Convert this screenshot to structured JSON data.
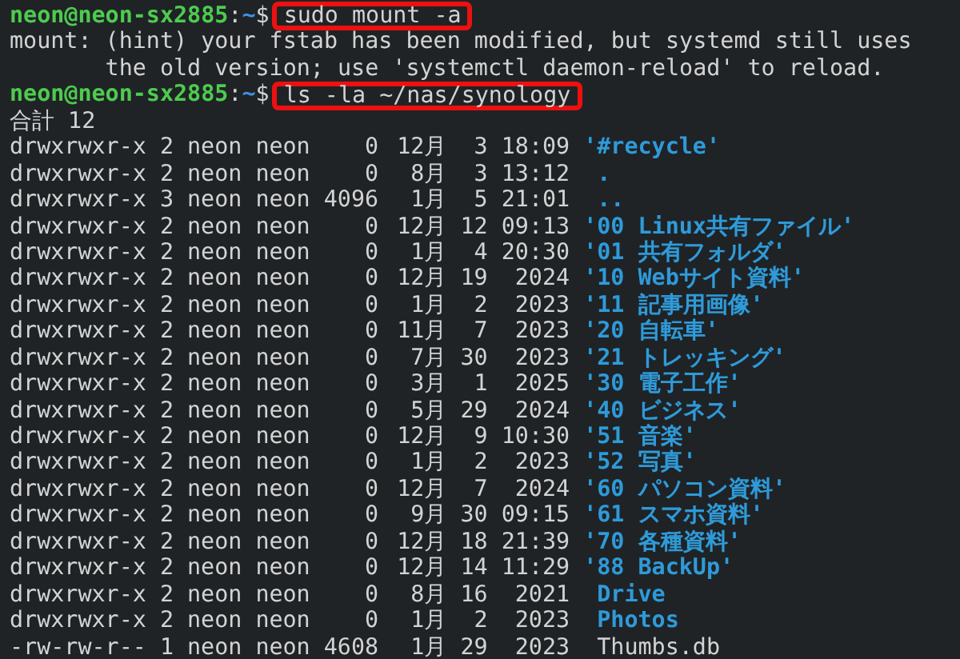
{
  "terminal": {
    "lines": [
      {
        "kind": "prompt",
        "user_host": "neon@neon-sx2885",
        "separator": ":",
        "path": "~",
        "symbol": "$",
        "command": "sudo mount -a",
        "highlighted": true
      },
      {
        "kind": "output",
        "text": "mount: (hint) your fstab has been modified, but systemd still uses"
      },
      {
        "kind": "output",
        "text": "       the old version; use 'systemctl daemon-reload' to reload."
      },
      {
        "kind": "prompt",
        "user_host": "neon@neon-sx2885",
        "separator": ":",
        "path": "~",
        "symbol": "$",
        "command": "ls -la ~/nas/synology",
        "highlighted": true
      },
      {
        "kind": "output",
        "text": "合計 12"
      }
    ],
    "listing": [
      {
        "perms": "drwxrwxr-x",
        "links": "2",
        "owner": "neon",
        "group": "neon",
        "size": "0",
        "month": "12月",
        "day": "3",
        "time": "18:09",
        "name": "'#recycle'",
        "kind": "directory",
        "quoted": true
      },
      {
        "perms": "drwxrwxr-x",
        "links": "2",
        "owner": "neon",
        "group": "neon",
        "size": "0",
        "month": "8月",
        "day": "3",
        "time": "13:12",
        "name": ".",
        "kind": "directory",
        "quoted": false
      },
      {
        "perms": "drwxrwxr-x",
        "links": "3",
        "owner": "neon",
        "group": "neon",
        "size": "4096",
        "month": "1月",
        "day": "5",
        "time": "21:01",
        "name": "..",
        "kind": "directory",
        "quoted": false
      },
      {
        "perms": "drwxrwxr-x",
        "links": "2",
        "owner": "neon",
        "group": "neon",
        "size": "0",
        "month": "12月",
        "day": "12",
        "time": "09:13",
        "name": "'00 Linux共有ファイル'",
        "kind": "directory",
        "quoted": true
      },
      {
        "perms": "drwxrwxr-x",
        "links": "2",
        "owner": "neon",
        "group": "neon",
        "size": "0",
        "month": "1月",
        "day": "4",
        "time": "20:30",
        "name": "'01 共有フォルダ'",
        "kind": "directory",
        "quoted": true
      },
      {
        "perms": "drwxrwxr-x",
        "links": "2",
        "owner": "neon",
        "group": "neon",
        "size": "0",
        "month": "12月",
        "day": "19",
        "time": "2024",
        "name": "'10 Webサイト資料'",
        "kind": "directory",
        "quoted": true
      },
      {
        "perms": "drwxrwxr-x",
        "links": "2",
        "owner": "neon",
        "group": "neon",
        "size": "0",
        "month": "1月",
        "day": "2",
        "time": "2023",
        "name": "'11 記事用画像'",
        "kind": "directory",
        "quoted": true
      },
      {
        "perms": "drwxrwxr-x",
        "links": "2",
        "owner": "neon",
        "group": "neon",
        "size": "0",
        "month": "11月",
        "day": "7",
        "time": "2023",
        "name": "'20 自転車'",
        "kind": "directory",
        "quoted": true
      },
      {
        "perms": "drwxrwxr-x",
        "links": "2",
        "owner": "neon",
        "group": "neon",
        "size": "0",
        "month": "7月",
        "day": "30",
        "time": "2023",
        "name": "'21 トレッキング'",
        "kind": "directory",
        "quoted": true
      },
      {
        "perms": "drwxrwxr-x",
        "links": "2",
        "owner": "neon",
        "group": "neon",
        "size": "0",
        "month": "3月",
        "day": "1",
        "time": "2025",
        "name": "'30 電子工作'",
        "kind": "directory",
        "quoted": true
      },
      {
        "perms": "drwxrwxr-x",
        "links": "2",
        "owner": "neon",
        "group": "neon",
        "size": "0",
        "month": "5月",
        "day": "29",
        "time": "2024",
        "name": "'40 ビジネス'",
        "kind": "directory",
        "quoted": true
      },
      {
        "perms": "drwxrwxr-x",
        "links": "2",
        "owner": "neon",
        "group": "neon",
        "size": "0",
        "month": "12月",
        "day": "9",
        "time": "10:30",
        "name": "'51 音楽'",
        "kind": "directory",
        "quoted": true
      },
      {
        "perms": "drwxrwxr-x",
        "links": "2",
        "owner": "neon",
        "group": "neon",
        "size": "0",
        "month": "1月",
        "day": "2",
        "time": "2023",
        "name": "'52 写真'",
        "kind": "directory",
        "quoted": true
      },
      {
        "perms": "drwxrwxr-x",
        "links": "2",
        "owner": "neon",
        "group": "neon",
        "size": "0",
        "month": "12月",
        "day": "7",
        "time": "2024",
        "name": "'60 パソコン資料'",
        "kind": "directory",
        "quoted": true
      },
      {
        "perms": "drwxrwxr-x",
        "links": "2",
        "owner": "neon",
        "group": "neon",
        "size": "0",
        "month": "9月",
        "day": "30",
        "time": "09:15",
        "name": "'61 スマホ資料'",
        "kind": "directory",
        "quoted": true
      },
      {
        "perms": "drwxrwxr-x",
        "links": "2",
        "owner": "neon",
        "group": "neon",
        "size": "0",
        "month": "12月",
        "day": "18",
        "time": "21:39",
        "name": "'70 各種資料'",
        "kind": "directory",
        "quoted": true
      },
      {
        "perms": "drwxrwxr-x",
        "links": "2",
        "owner": "neon",
        "group": "neon",
        "size": "0",
        "month": "12月",
        "day": "14",
        "time": "11:29",
        "name": "'88 BackUp'",
        "kind": "directory",
        "quoted": true
      },
      {
        "perms": "drwxrwxr-x",
        "links": "2",
        "owner": "neon",
        "group": "neon",
        "size": "0",
        "month": "8月",
        "day": "16",
        "time": "2021",
        "name": "Drive",
        "kind": "directory",
        "quoted": false
      },
      {
        "perms": "drwxrwxr-x",
        "links": "2",
        "owner": "neon",
        "group": "neon",
        "size": "0",
        "month": "1月",
        "day": "2",
        "time": "2023",
        "name": "Photos",
        "kind": "directory",
        "quoted": false
      },
      {
        "perms": "-rw-rw-r--",
        "links": "1",
        "owner": "neon",
        "group": "neon",
        "size": "4608",
        "month": "1月",
        "day": "29",
        "time": "2023",
        "name": "Thumbs.db",
        "kind": "file",
        "quoted": false
      }
    ]
  }
}
